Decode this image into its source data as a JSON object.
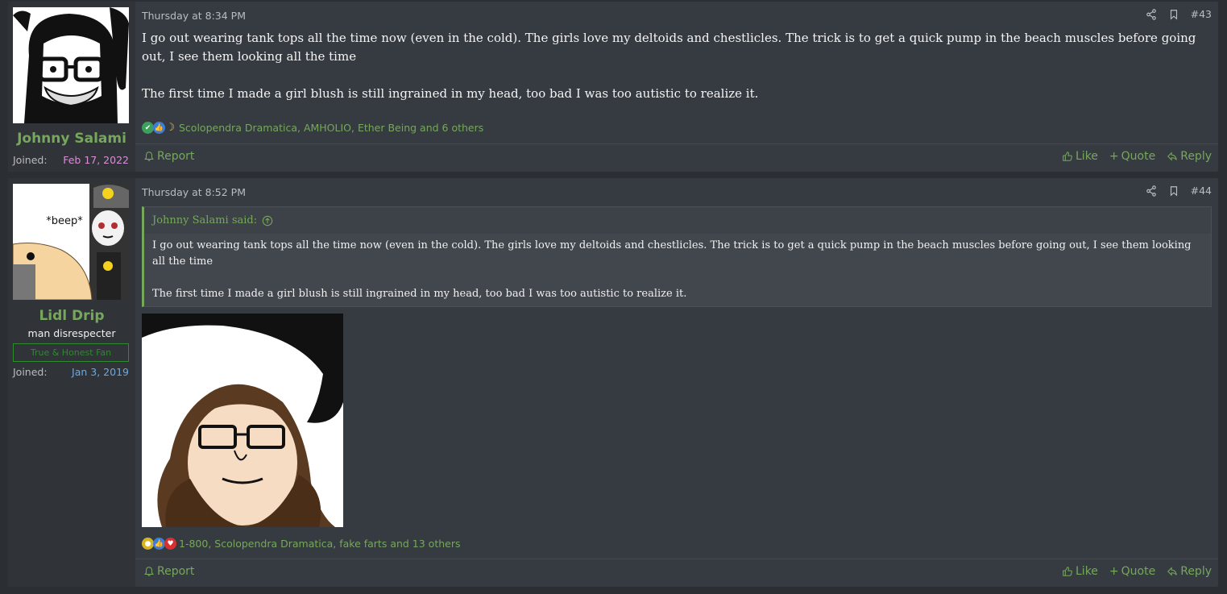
{
  "posts": [
    {
      "username": "Johnny Salami",
      "joined_label": "Joined:",
      "joined_date": "Feb 17, 2022",
      "joined_color": "#d98fd8",
      "timestamp": "Thursday at 8:34 PM",
      "post_number": "#43",
      "paragraphs": [
        "I go out wearing tank tops all the time now (even in the cold). The girls love my deltoids and chestlicles. The trick is to get a quick pump in the beach muscles before going out, I see them looking all the time",
        "The first time I made a girl blush is still ingrained in my head, too bad I was too autistic to realize it."
      ],
      "reactions_text": "Scolopendra Dramatica, AMHOLIO, Ether Being and 6 others",
      "report_label": "Report",
      "like_label": "Like",
      "quote_label": "Quote",
      "reply_label": "Reply"
    },
    {
      "username": "Lidl Drip",
      "user_title": "man disrespecter",
      "user_banner": "True & Honest Fan",
      "avatar_text": "*beep*",
      "joined_label": "Joined:",
      "joined_date": "Jan 3, 2019",
      "joined_color": "#6fa8dc",
      "timestamp": "Thursday at 8:52 PM",
      "post_number": "#44",
      "quote_author": "Johnny Salami said:",
      "quote_paragraphs": [
        "I go out wearing tank tops all the time now (even in the cold). The girls love my deltoids and chestlicles. The trick is to get a quick pump in the beach muscles before going out, I see them looking all the time",
        "The first time I made a girl blush is still ingrained in my head, too bad I was too autistic to realize it."
      ],
      "reactions_text": "1-800, Scolopendra Dramatica, fake farts and 13 others",
      "report_label": "Report",
      "like_label": "Like",
      "quote_label": "Quote",
      "reply_label": "Reply"
    }
  ],
  "colors": {
    "accent_green": "#76a85c",
    "page_bg": "#2b2e33",
    "post_bg": "#363a41"
  }
}
